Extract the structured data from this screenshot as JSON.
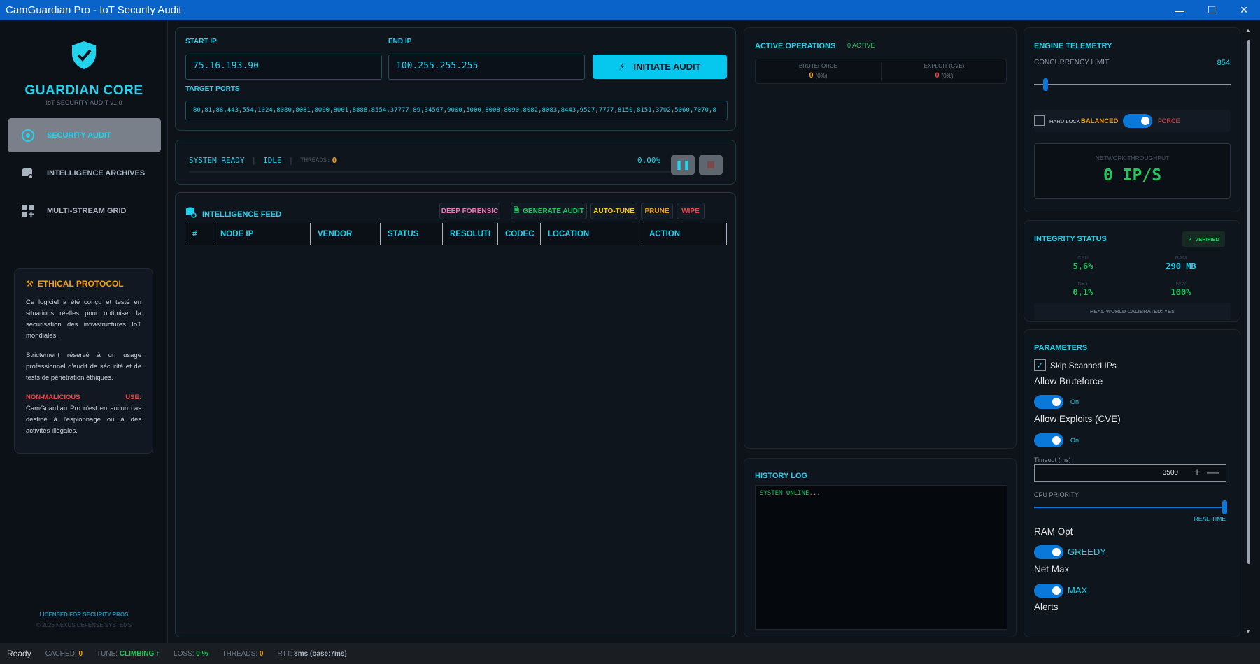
{
  "window": {
    "title": "CamGuardian Pro - IoT Security Audit"
  },
  "sidebar": {
    "brand": "GUARDIAN CORE",
    "brand_sub": "IoT SECURITY AUDIT v1.0",
    "items": [
      {
        "label": "SECURITY AUDIT"
      },
      {
        "label": "INTELLIGENCE ARCHIVES"
      },
      {
        "label": "MULTI-STREAM GRID"
      }
    ],
    "ethical": {
      "title": "ETHICAL PROTOCOL",
      "p1": "Ce logiciel a été conçu et testé en situations réelles pour optimiser la sécurisation des infrastructures IoT mondiales.",
      "p2": "Strictement réservé à un usage professionnel d'audit de sécurité et de tests de pénétration éthiques.",
      "warn_a": "NON-MALICIOUS",
      "warn_b": "USE:",
      "p3": "CamGuardian Pro n'est en aucun cas destiné à l'espionnage ou à des activités illégales."
    },
    "footer1": "LICENSED FOR SECURITY PROS",
    "footer2": "© 2026 NEXUS DEFENSE SYSTEMS"
  },
  "audit": {
    "start_ip_label": "START IP",
    "start_ip": "75.16.193.90",
    "end_ip_label": "END IP",
    "end_ip": "100.255.255.255",
    "initiate": "INITIATE AUDIT",
    "ports_label": "TARGET PORTS",
    "ports": "80,81,88,443,554,1024,8080,8081,8000,8001,8888,8554,37777,89,34567,9000,5000,8008,8090,8082,8083,8443,9527,7777,8150,8151,3702,5060,7070,8"
  },
  "progress": {
    "system": "SYSTEM READY",
    "state": "IDLE",
    "threads_label": "THREADS:",
    "threads": "0",
    "percent": "0.00%",
    "fraction": 0.0
  },
  "feed": {
    "title": "INTELLIGENCE FEED",
    "buttons": {
      "forensic": "DEEP FORENSIC",
      "generate": "GENERATE AUDIT",
      "autotune": "AUTO-TUNE",
      "prune": "PRUNE",
      "wipe": "WIPE"
    },
    "columns": [
      "#",
      "NODE IP",
      "VENDOR",
      "STATUS",
      "RESOLUTI",
      "CODEC",
      "LOCATION",
      "ACTION"
    ]
  },
  "ops": {
    "title": "ACTIVE OPERATIONS",
    "active": "0 ACTIVE",
    "brute_label": "BRUTEFORCE",
    "brute_val": "0",
    "brute_pct": "(0%)",
    "exploit_label": "EXPLOIT (CVE)",
    "exploit_val": "0",
    "exploit_pct": "(0%)"
  },
  "history": {
    "title": "HISTORY LOG",
    "line1": "SYSTEM ONLINE..."
  },
  "telemetry": {
    "title": "ENGINE TELEMETRY",
    "concurrency_label": "CONCURRENCY LIMIT",
    "concurrency": "854",
    "hardlock": "HARD LOCK",
    "balanced": "BALANCED",
    "force": "FORCE",
    "throughput_label": "NETWORK THROUGHPUT",
    "throughput": "0 IP/S"
  },
  "integrity": {
    "title": "INTEGRITY STATUS",
    "verified": "VERIFIED",
    "cpu_l": "CPU",
    "cpu": "5,6%",
    "ram_l": "RAM",
    "ram": "290 MB",
    "net_l": "NET",
    "net": "0,1%",
    "nav_l": "NAV",
    "nav": "100%",
    "calibrated": "REAL-WORLD CALIBRATED: YES"
  },
  "params": {
    "title": "PARAMETERS",
    "skip": "Skip Scanned IPs",
    "brute": "Allow Bruteforce",
    "brute_state": "On",
    "exploit": "Allow Exploits (CVE)",
    "exploit_state": "On",
    "timeout_label": "Timeout (ms)",
    "timeout": "3500",
    "cpu_label": "CPU PRIORITY",
    "cpu_val": "REAL-TIME",
    "ram": "RAM Opt",
    "ram_val": "GREEDY",
    "net": "Net Max",
    "net_val": "MAX",
    "alerts": "Alerts"
  },
  "status": {
    "ready": "Ready",
    "cached_l": "CACHED:",
    "cached": "0",
    "tune_l": "TUNE:",
    "tune": "CLIMBING ↑",
    "loss_l": "LOSS:",
    "loss": "0 %",
    "threads_l": "THREADS:",
    "threads": "0",
    "rtt_l": "RTT:",
    "rtt": "8ms (base:7ms)"
  },
  "colors": {
    "accent": "#22d3ee",
    "brand_blue": "#0a63c9",
    "green": "#22c55e",
    "orange": "#f59e0b",
    "red": "#ef4444",
    "pink": "#f472b6"
  }
}
